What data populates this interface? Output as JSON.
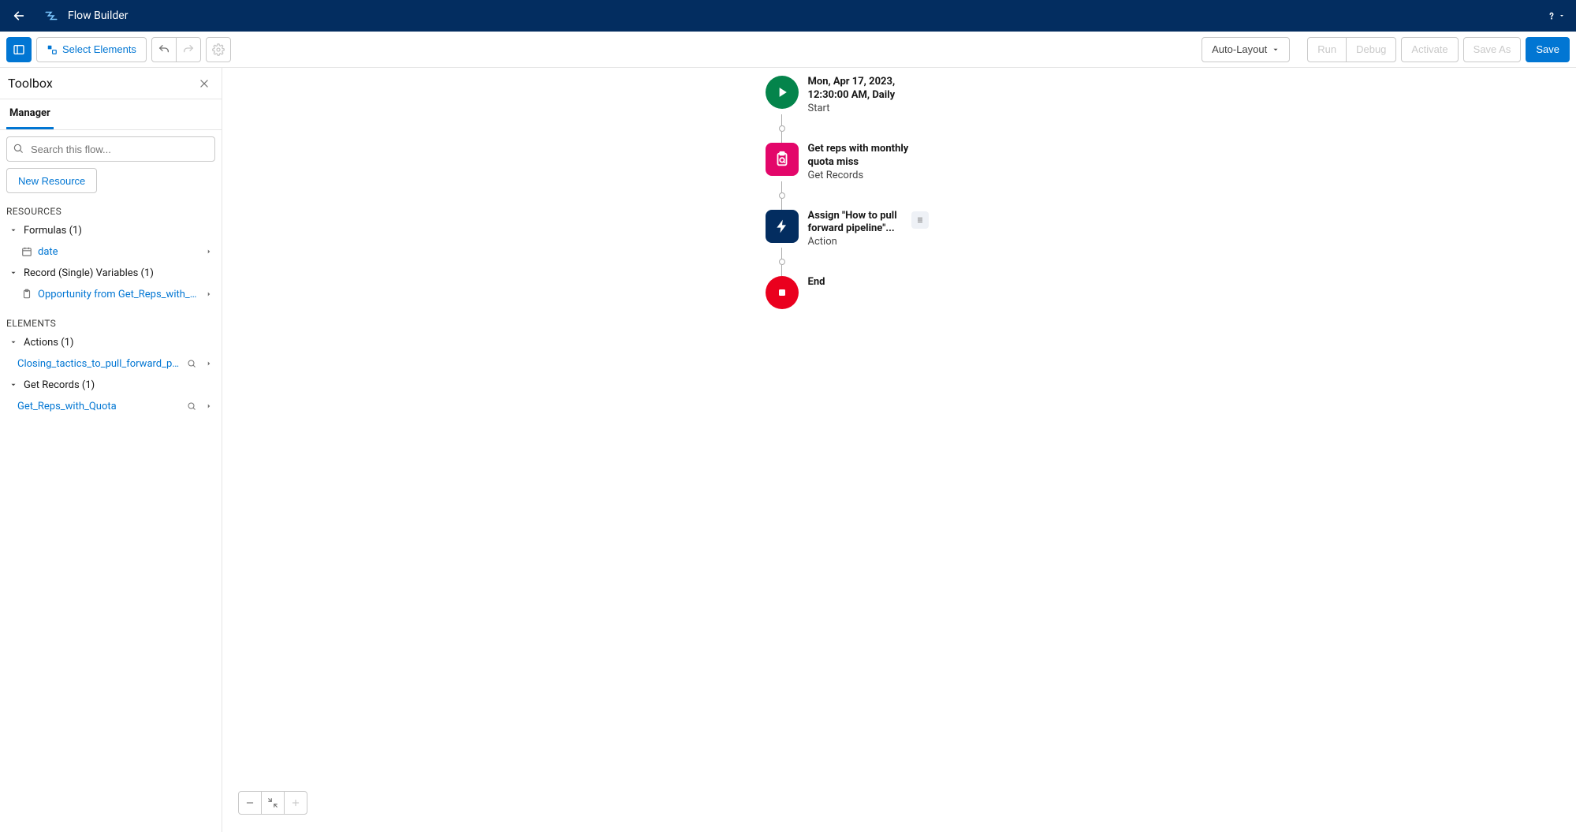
{
  "header": {
    "app_title": "Flow Builder"
  },
  "actionbar": {
    "select_elements": "Select Elements",
    "layout_dropdown": "Auto-Layout",
    "run": "Run",
    "debug": "Debug",
    "activate": "Activate",
    "save_as": "Save As",
    "save": "Save"
  },
  "toolbox": {
    "title": "Toolbox",
    "tab_manager": "Manager",
    "search_placeholder": "Search this flow...",
    "new_resource": "New Resource",
    "section_resources": "RESOURCES",
    "section_elements": "ELEMENTS",
    "tree": {
      "formulas": "Formulas (1)",
      "formula_date": "date",
      "record_vars": "Record (Single) Variables (1)",
      "record_var_item": "Opportunity from Get_Reps_with_Q...",
      "actions": "Actions (1)",
      "action_item": "Closing_tactics_to_pull_forward_pi...",
      "get_records": "Get Records (1)",
      "get_records_item": "Get_Reps_with_Quota"
    }
  },
  "flow": {
    "start": {
      "title_line1": "Mon, Apr 17, 2023,",
      "title_line2": "12:30:00 AM, Daily",
      "subtitle": "Start"
    },
    "get_records": {
      "title_line1": "Get reps with monthly",
      "title_line2": "quota miss",
      "subtitle": "Get Records"
    },
    "action": {
      "title_line1": "Assign \"How to pull",
      "title_line2": "forward pipeline\"...",
      "subtitle": "Action"
    },
    "end": {
      "title": "End"
    }
  }
}
